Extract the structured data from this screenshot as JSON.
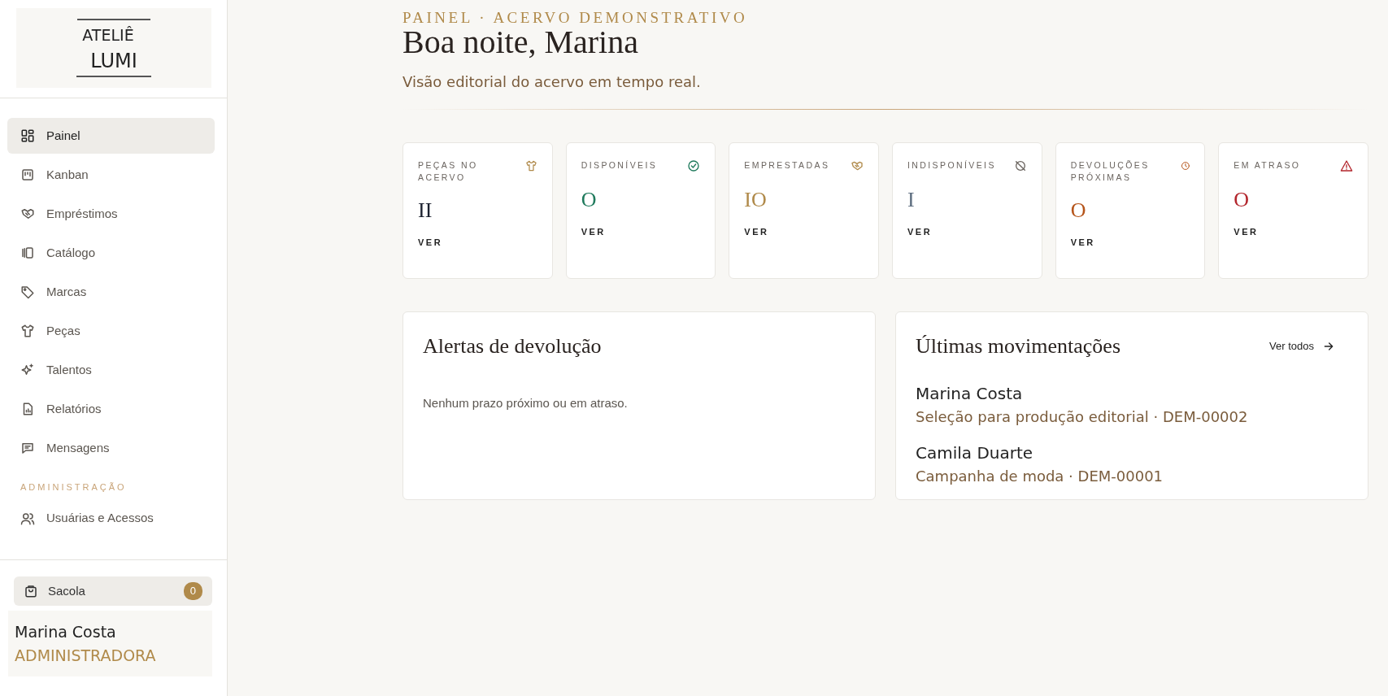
{
  "brand": {
    "line1": "ATELIÊ",
    "line2": "LUMI"
  },
  "nav": [
    {
      "label": "Painel",
      "selected": true
    },
    {
      "label": "Kanban",
      "selected": false
    },
    {
      "label": "Empréstimos",
      "selected": false
    },
    {
      "label": "Catálogo",
      "selected": false
    },
    {
      "label": "Marcas",
      "selected": false
    },
    {
      "label": "Peças",
      "selected": false
    },
    {
      "label": "Talentos",
      "selected": false
    },
    {
      "label": "Relatórios",
      "selected": false
    },
    {
      "label": "Mensagens",
      "selected": false
    }
  ],
  "admin_section": {
    "title": "ADMINISTRAÇÃO",
    "items": [
      {
        "label": "Usuárias e Acessos",
        "selected": false
      }
    ]
  },
  "bag": {
    "label": "Sacola",
    "count": "0"
  },
  "user": {
    "name": "Marina Costa",
    "role": "ADMINISTRADORA"
  },
  "header": {
    "eyebrow": "PAINEL · ACERVO DEMONSTRATIVO",
    "title": "Boa noite, Marina",
    "subtitle": "Visão editorial do acervo em tempo real."
  },
  "stats": [
    {
      "label": "PEÇAS NO ACERVO",
      "value": "II",
      "color": "#1c2230",
      "action": "VER"
    },
    {
      "label": "DISPONÍVEIS",
      "value": "O",
      "color": "#1f7a5c",
      "action": "VER"
    },
    {
      "label": "EMPRESTADAS",
      "value": "IO",
      "color": "#b08a4a",
      "action": "VER"
    },
    {
      "label": "INDISPONÍVEIS",
      "value": "I",
      "color": "#5e6e80",
      "action": "VER"
    },
    {
      "label": "DEVOLUÇÕES PRÓXIMAS",
      "value": "O",
      "color": "#b5541a",
      "action": "VER"
    },
    {
      "label": "EM ATRASO",
      "value": "O",
      "color": "#b3262d",
      "action": "VER"
    }
  ],
  "alerts": {
    "title": "Alertas de devolução",
    "empty": "Nenhum prazo próximo ou em atraso."
  },
  "movements": {
    "title": "Últimas movimentações",
    "link": "Ver todos",
    "items": [
      {
        "name": "Marina Costa",
        "detail": "Seleção para produção editorial · DEM-00002"
      },
      {
        "name": "Camila Duarte",
        "detail": "Campanha de moda · DEM-00001"
      }
    ]
  }
}
